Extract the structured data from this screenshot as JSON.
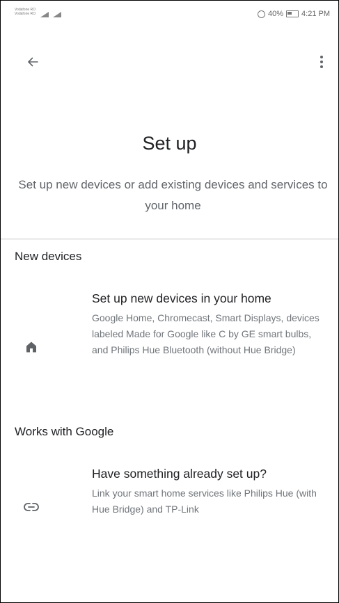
{
  "status_bar": {
    "carrier_line1": "Vodafone RO",
    "carrier_line2": "Vodafone RO",
    "battery": "40%",
    "time": "4:21 PM"
  },
  "app_bar": {
    "back_icon": "arrow-left-icon",
    "more_icon": "more-vertical-icon"
  },
  "header": {
    "title": "Set up",
    "subtitle": "Set up new devices or add existing devices and services to your home"
  },
  "sections": [
    {
      "header": "New devices",
      "item": {
        "icon": "home-icon",
        "title": "Set up new devices in your home",
        "description": "Google Home, Chromecast, Smart Displays, devices labeled Made for Google like C by GE smart bulbs, and Philips Hue Bluetooth (without Hue Bridge)"
      }
    },
    {
      "header": "Works with Google",
      "item": {
        "icon": "link-icon",
        "title": "Have something already set up?",
        "description": "Link your smart home services like Philips Hue (with Hue Bridge) and TP-Link"
      }
    }
  ],
  "colors": {
    "text_primary": "#202124",
    "text_secondary": "#70757a",
    "divider": "#eeeeee",
    "icon": "#5f6368"
  }
}
